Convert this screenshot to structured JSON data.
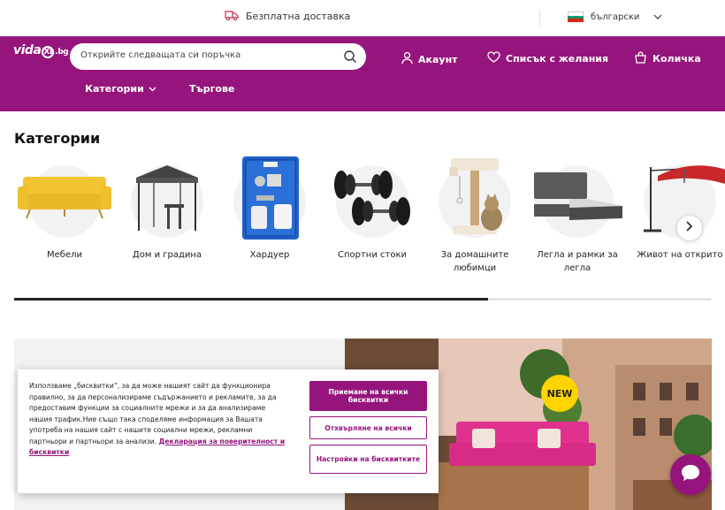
{
  "topbar": {
    "shipping_text": "Безплатна доставка",
    "language": "български",
    "flag_colors": [
      "#ffffff",
      "#00966e",
      "#d62612"
    ]
  },
  "header": {
    "logo_main": "vida",
    "logo_suffix": ".bg",
    "search_placeholder": "Открийте следващата си поръчка",
    "account_label": "Акаунт",
    "wishlist_label": "Списък с желания",
    "cart_label": "Количка",
    "categories_label": "Категории",
    "trade_label": "Търгове",
    "brand_color": "#96157d"
  },
  "categories": {
    "title": "Категории",
    "items": [
      {
        "label": "Мебели",
        "icon": "yellow-sofa"
      },
      {
        "label": "Дом и градина",
        "icon": "gazebo"
      },
      {
        "label": "Хардуер",
        "icon": "spray-gun-kit"
      },
      {
        "label": "Спортни стоки",
        "icon": "dumbbells"
      },
      {
        "label": "За домашните любимци",
        "icon": "cat-tree"
      },
      {
        "label": "Легла и рамки за легла",
        "icon": "bed"
      },
      {
        "label": "Живот на открито",
        "icon": "parasol"
      }
    ],
    "scroll_progress": 0.68
  },
  "banner": {
    "badge": "NEW"
  },
  "cookie": {
    "text": "Използваме „бисквитки“, за да може нашият сайт да функционира правилно, за да персонализираме съдържанието и рекламите, за да предоставим функции за социалните мрежи и за да анализираме нашия трафик.Ние също така споделяме информация за Вашата употреба на нашия сайт с нашите социални мрежи, рекламни партньори и партньори за анализи.",
    "link": "Декларация за поверителност и бисквитки",
    "accept": "Приемане на всички бисквитки",
    "reject": "Отхвърляне на всички",
    "settings": "Настройки на бисквитките"
  }
}
